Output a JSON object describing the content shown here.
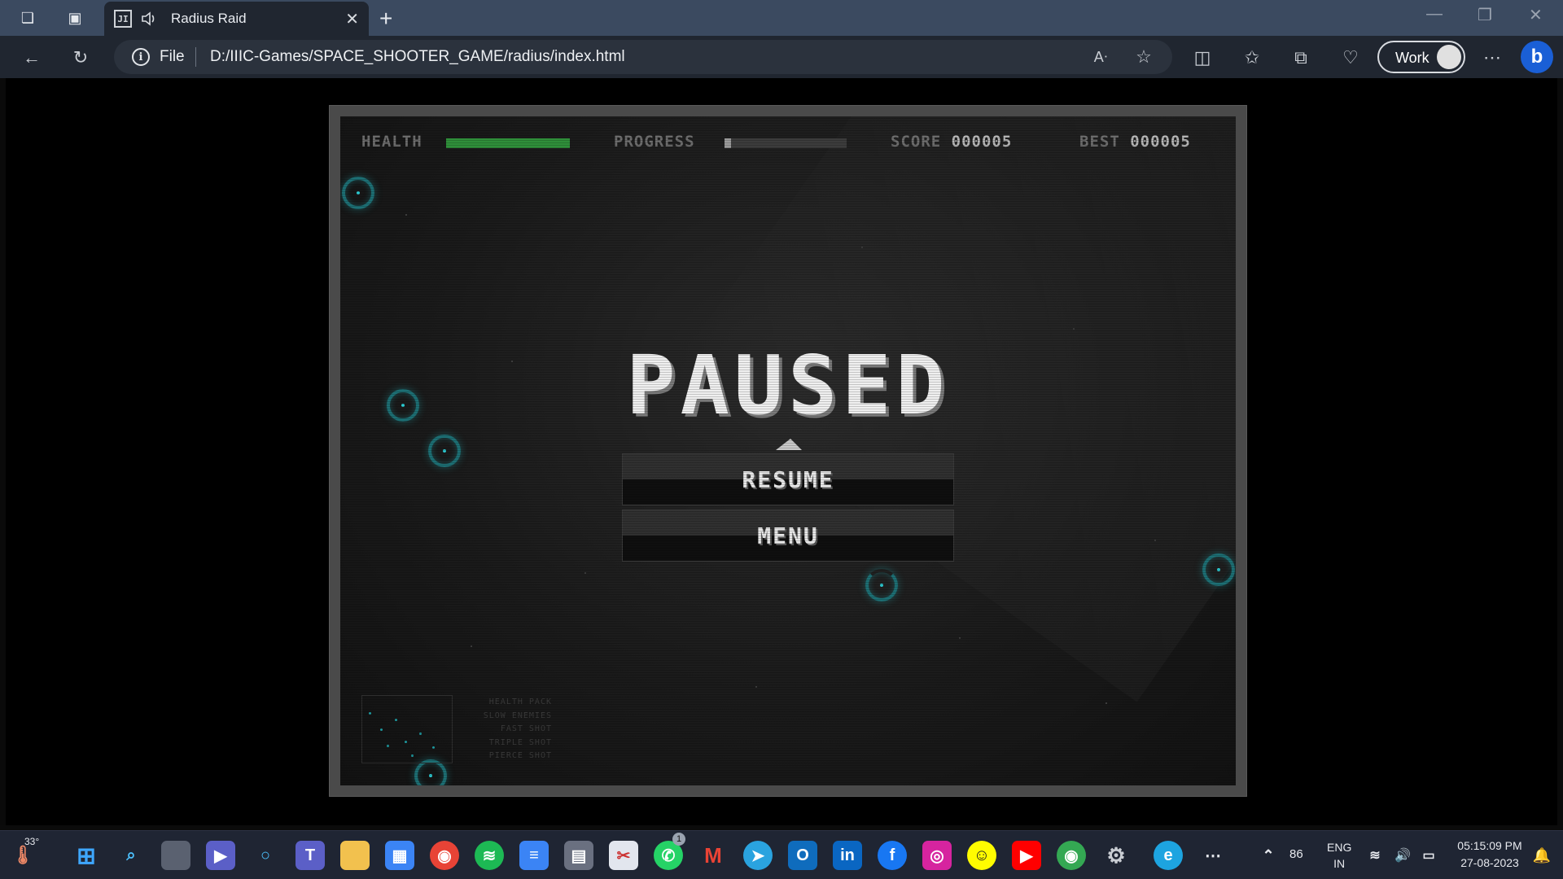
{
  "browser": {
    "tab_title": "Radius Raid",
    "tab_favicon": "JI",
    "address_scheme": "File",
    "address_url": "D:/IIIC-Games/SPACE_SHOOTER_GAME/radius/index.html",
    "profile_label": "Work",
    "icons": [
      "workspaces-icon",
      "tab-actions-icon",
      "speaker-icon",
      "close-tab-icon",
      "new-tab-icon",
      "minimize-icon",
      "restore-icon",
      "close-window-icon",
      "back-icon",
      "refresh-icon",
      "info-icon",
      "read-aloud-icon",
      "favorite-star-icon",
      "split-screen-icon",
      "favorites-icon",
      "collections-icon",
      "browser-essentials-icon",
      "more-icon",
      "bing-copilot-icon"
    ]
  },
  "game": {
    "hud": {
      "health_label": "HEALTH",
      "health_fraction": 1.0,
      "progress_label": "PROGRESS",
      "progress_fraction": 0.05,
      "score_label": "SCORE",
      "score_value": "000005",
      "best_label": "BEST",
      "best_value": "000005"
    },
    "title": "PAUSED",
    "buttons": {
      "resume": "RESUME",
      "menu": "MENU"
    },
    "legend": [
      "HEALTH PACK",
      "SLOW ENEMIES",
      "FAST SHOT",
      "TRIPLE SHOT",
      "PIERCE SHOT"
    ],
    "colors": {
      "health": "#2f8f3a",
      "progress": "#8a8a8a",
      "enemy": "#1d6f74"
    }
  },
  "taskbar": {
    "weather_temp": "33°",
    "battery": "86",
    "lang_primary": "ENG",
    "lang_secondary": "IN",
    "time": "05:15:09 PM",
    "date": "27-08-2023",
    "whatsapp_badge": "1",
    "apps": [
      "start-icon",
      "search-icon",
      "task-view-icon",
      "meet-icon",
      "cortana-icon",
      "teams-icon",
      "file-explorer-icon",
      "store-icon",
      "chrome-icon",
      "spotify-icon",
      "notepad-icon",
      "calculator-icon",
      "snipping-tool-icon",
      "whatsapp-icon",
      "gmail-icon",
      "telegram-icon",
      "outlook-icon",
      "linkedin-icon",
      "facebook-icon",
      "instagram-icon",
      "snapchat-icon",
      "youtube-icon",
      "chrome-profile-icon",
      "settings-icon",
      "edge-icon",
      "more-apps-icon"
    ]
  }
}
